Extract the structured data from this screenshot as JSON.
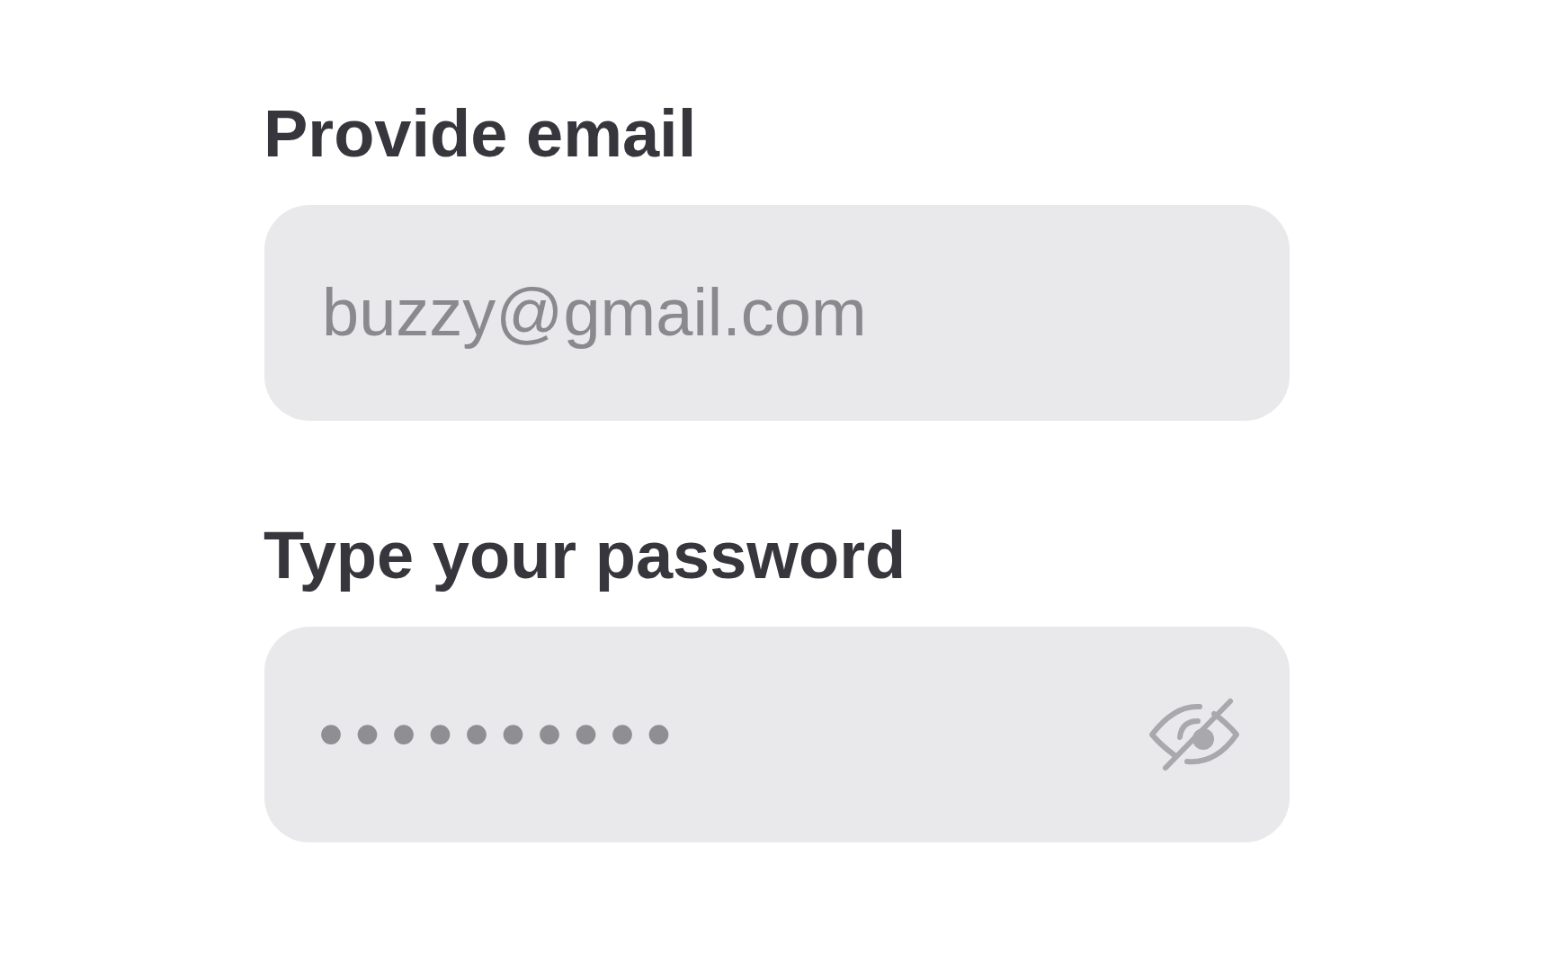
{
  "email": {
    "label": "Provide email",
    "value": "buzzy@gmail.com"
  },
  "password": {
    "label": "Type your password",
    "value": "••••••••••"
  }
}
